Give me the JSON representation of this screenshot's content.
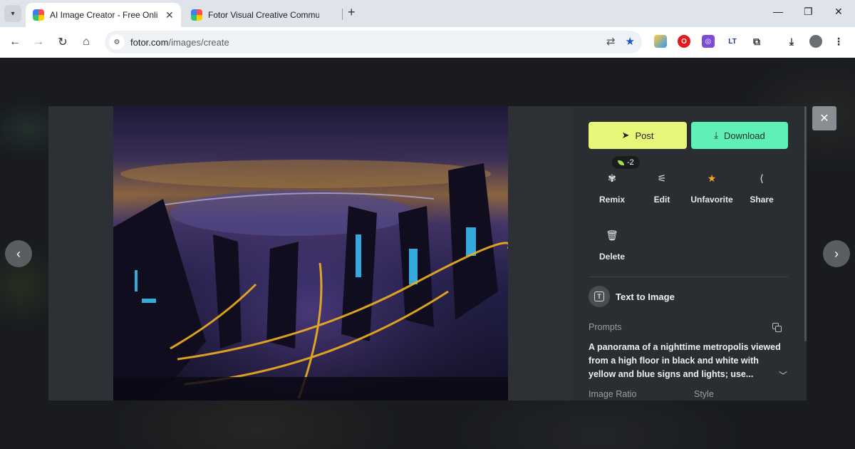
{
  "browser": {
    "tabs": [
      {
        "title": "AI Image Creator - Free Online",
        "active": true
      },
      {
        "title": "Fotor Visual Creative Commun",
        "active": false
      }
    ],
    "new_tab_glyph": "+",
    "url_host": "fotor.com",
    "url_path": "/images/create",
    "window_controls": {
      "minimize": "—",
      "maximize": "❐",
      "close": "✕"
    },
    "nav": {
      "back": "←",
      "forward": "→",
      "reload": "↻",
      "home": "⌂"
    }
  },
  "modal": {
    "close_glyph": "✕",
    "prev_glyph": "‹",
    "next_glyph": "›",
    "buttons": {
      "post": "Post",
      "download": "Download"
    },
    "credit_badge": "-2",
    "actions": [
      {
        "label": "Remix",
        "icon": "remix-icon"
      },
      {
        "label": "Edit",
        "icon": "sliders-icon"
      },
      {
        "label": "Unfavorite",
        "icon": "star-icon"
      },
      {
        "label": "Share",
        "icon": "share-icon"
      },
      {
        "label": "Delete",
        "icon": "trash-icon"
      }
    ],
    "mode_label": "Text to Image",
    "prompts_heading": "Prompts",
    "prompt_text": "A panorama of a nighttime metropolis viewed from a high floor in black and white with yellow and blue signs and lights; use...",
    "image_ratio_heading": "Image Ratio",
    "style_heading": "Style"
  },
  "colors": {
    "post_button": "#e6f77a",
    "download_button": "#5ff0b6",
    "star": "#f5a623",
    "panel_bg": "#2a2d31"
  }
}
